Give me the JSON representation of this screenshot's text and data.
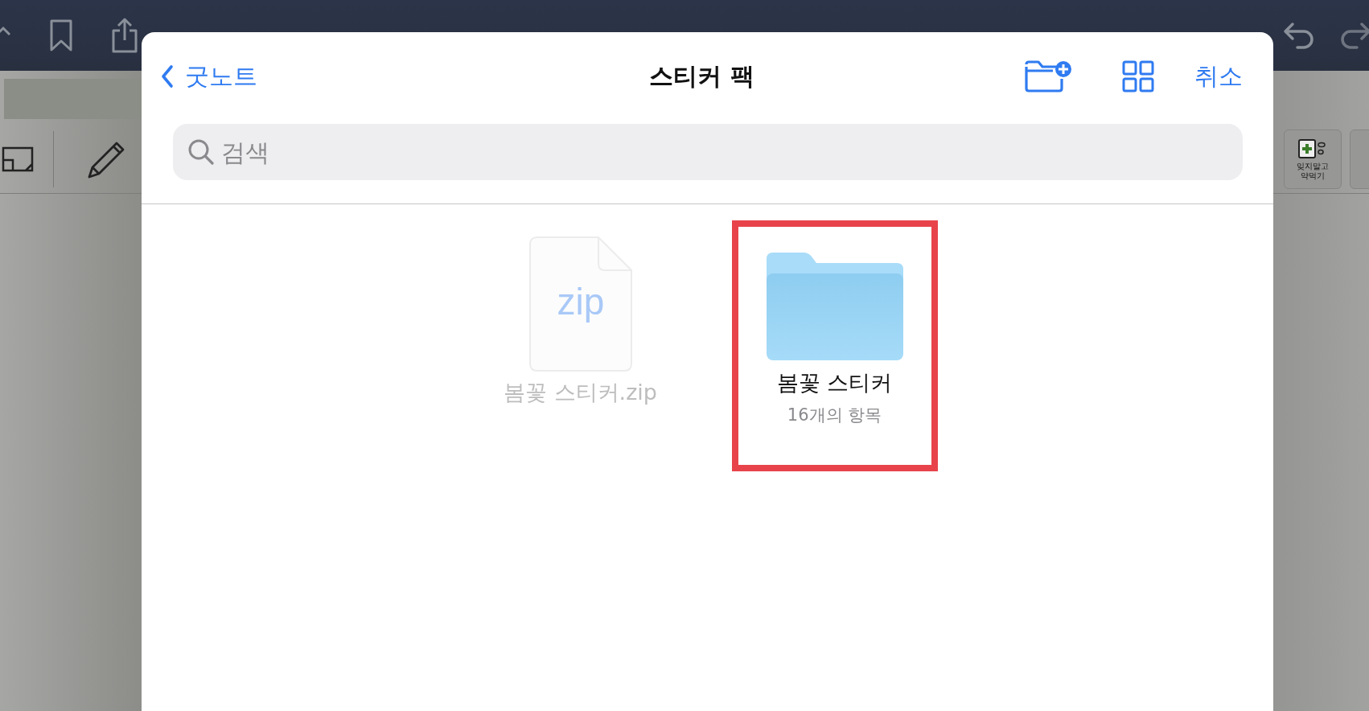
{
  "stickers": [
    {
      "label": "잊지말고 약먹기"
    }
  ],
  "sheet": {
    "back_label": "굿노트",
    "title": "스티커 팩",
    "cancel_label": "취소",
    "search": {
      "placeholder": "검색"
    },
    "items": [
      {
        "kind": "archive",
        "type_label": "zip",
        "name": "봄꽃 스티커.zip",
        "disabled": true,
        "highlighted": false
      },
      {
        "kind": "folder",
        "name": "봄꽃 스티커",
        "count": "16개의 항목",
        "disabled": false,
        "highlighted": true
      }
    ]
  }
}
